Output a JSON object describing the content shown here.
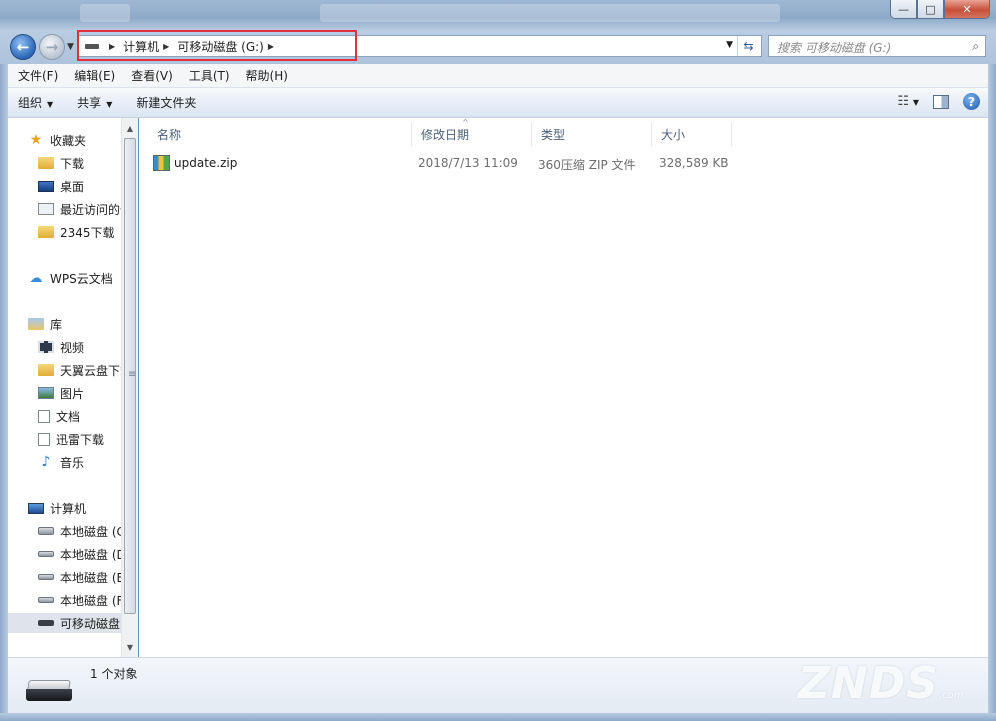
{
  "window": {
    "minimize_glyph": "—",
    "maximize_glyph": "□",
    "close_glyph": "✕"
  },
  "address": {
    "crumbs": [
      "计算机",
      "可移动磁盘 (G:)"
    ],
    "search_placeholder": "搜索 可移动磁盘 (G:)"
  },
  "menu": [
    "文件(F)",
    "编辑(E)",
    "查看(V)",
    "工具(T)",
    "帮助(H)"
  ],
  "commands": {
    "organize": "组织",
    "share": "共享",
    "new_folder": "新建文件夹"
  },
  "nav": {
    "favorites": "收藏夹",
    "downloads": "下载",
    "desktop": "桌面",
    "recent": "最近访问的位置",
    "d2345": "2345下载",
    "wps": "WPS云文档",
    "libraries": "库",
    "videos": "视频",
    "tianyi": "天翼云盘下载",
    "pictures": "图片",
    "documents": "文档",
    "xunlei": "迅雷下载",
    "music": "音乐",
    "computer": "计算机",
    "drive_c": "本地磁盘 (C:)",
    "drive_d": "本地磁盘 (D:)",
    "drive_e": "本地磁盘 (E:)",
    "drive_f": "本地磁盘 (F:)",
    "drive_g": "可移动磁盘 (G:)"
  },
  "columns": {
    "name": "名称",
    "modified": "修改日期",
    "type": "类型",
    "size": "大小"
  },
  "files": [
    {
      "name": "update.zip",
      "modified": "2018/7/13 11:09",
      "type": "360压缩 ZIP 文件",
      "size": "328,589 KB"
    }
  ],
  "status": {
    "object_count": "1 个对象"
  },
  "watermark": {
    "brand": "ZNDS",
    "domain": ".com"
  },
  "colors": {
    "highlight_box": "#e0323c",
    "glass_frame": "#9fb7d3"
  }
}
